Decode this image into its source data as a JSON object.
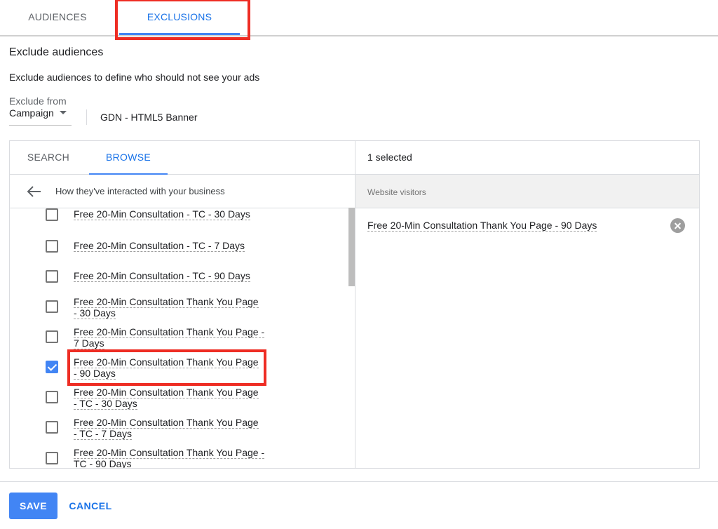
{
  "top_tabs": [
    {
      "label": "AUDIENCES",
      "active": false
    },
    {
      "label": "EXCLUSIONS",
      "active": true
    }
  ],
  "section": {
    "title": "Exclude audiences",
    "description": "Exclude audiences to define who should not see your ads"
  },
  "exclude_from": {
    "label": "Exclude from",
    "value": "Campaign",
    "campaign_name": "GDN - HTML5 Banner"
  },
  "browse_panel": {
    "tabs": [
      {
        "label": "SEARCH",
        "active": false
      },
      {
        "label": "BROWSE",
        "active": true
      }
    ],
    "breadcrumb": "How they've interacted with your business",
    "items": [
      {
        "line1": "Free 20-Min Consultation - TC - 30 Days",
        "line2": "",
        "checked": false
      },
      {
        "line1": "Free 20-Min Consultation - TC - 7 Days",
        "line2": "",
        "checked": false
      },
      {
        "line1": "Free 20-Min Consultation - TC - 90 Days",
        "line2": "",
        "checked": false
      },
      {
        "line1": "Free 20-Min Consultation Thank You Page",
        "line2": "- 30 Days",
        "checked": false
      },
      {
        "line1": "Free 20-Min Consultation Thank You Page -",
        "line2": "7 Days",
        "checked": false
      },
      {
        "line1": "Free 20-Min Consultation Thank You Page",
        "line2": "- 90 Days",
        "checked": true
      },
      {
        "line1": "Free 20-Min Consultation Thank You Page",
        "line2": "- TC - 30 Days",
        "checked": false
      },
      {
        "line1": "Free 20-Min Consultation Thank You Page",
        "line2": "- TC - 7 Days",
        "checked": false
      },
      {
        "line1": "Free 20-Min Consultation Thank You Page -",
        "line2": "TC - 90 Days",
        "checked": false
      }
    ]
  },
  "selected_panel": {
    "count": "1 selected",
    "group": "Website visitors",
    "items": [
      "Free 20-Min Consultation Thank You Page - 90 Days"
    ]
  },
  "footer": {
    "save": "SAVE",
    "cancel": "CANCEL"
  },
  "colors": {
    "accent": "#4285f4",
    "annotation": "#ee2d24"
  }
}
